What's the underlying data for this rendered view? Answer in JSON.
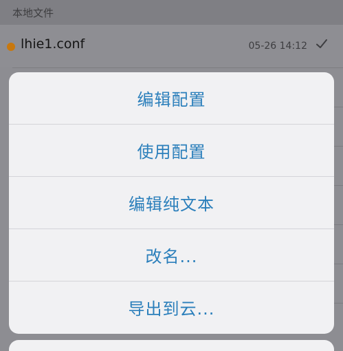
{
  "list": {
    "section_title": "本地文件",
    "file": {
      "name": "lhie1.conf",
      "time": "05-26 14:12",
      "status_color": "#c8780e",
      "check_icon": "checkmark-icon"
    }
  },
  "action_sheet": {
    "items": [
      {
        "label": "编辑配置"
      },
      {
        "label": "使用配置"
      },
      {
        "label": "编辑纯文本"
      },
      {
        "label": "改名..."
      },
      {
        "label": "导出到云..."
      }
    ]
  },
  "colors": {
    "accent": "#2b7fbb",
    "overlay": "#8d8d92",
    "sheet_bg": "#f1f1f3"
  }
}
